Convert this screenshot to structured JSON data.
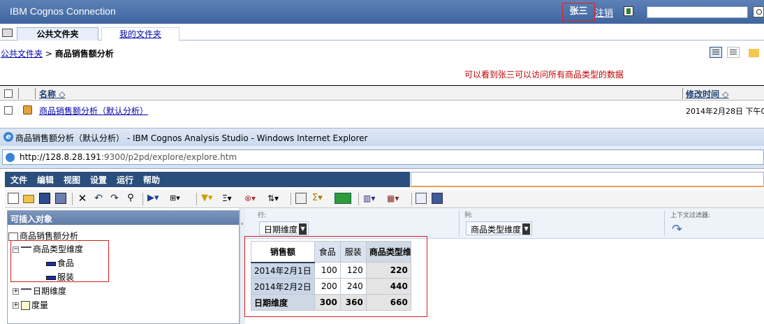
{
  "connection": {
    "app_title": "IBM Cognos Connection",
    "user_name": "张三",
    "logoff": "注销",
    "search_value": "",
    "tabs": [
      {
        "label": "公共文件夹"
      },
      {
        "label": "我的文件夹"
      }
    ],
    "breadcrumb": {
      "root": "公共文件夹",
      "separator": ">",
      "current": "商品销售额分析"
    },
    "annotation": "可以看到张三可以访问所有商品类型的数据",
    "list": {
      "col_name": "名称",
      "col_modified": "修改时间",
      "rows": [
        {
          "name": "商品销售额分析（默认分析）",
          "modified": "2014年2月28日  下午0"
        }
      ]
    }
  },
  "browser": {
    "window_title": "商品销售额分析（默认分析） - IBM Cognos Analysis Studio - Windows Internet Explorer",
    "url_host": "http://128.8.28.191",
    "url_rest": ":9300/p2pd/explore/explore.htm"
  },
  "analysis": {
    "menu": [
      "文件",
      "编辑",
      "视图",
      "设置",
      "运行",
      "帮助"
    ],
    "insertable": {
      "title": "可插入对象",
      "package": "商品销售额分析",
      "dimension_product": "商品类型维度",
      "levels": [
        "食品",
        "服装"
      ],
      "dimension_date": "日期维度",
      "measures": "度量"
    },
    "dropzones": {
      "rows_label": "行:",
      "rows_item": "日期维度",
      "cols_label": "列:",
      "cols_item": "商品类型维度",
      "context_label": "上下文过滤器:"
    },
    "crosstab": {
      "measure": "销售额",
      "columns": [
        "食品",
        "服装",
        "商品类型维度"
      ],
      "rows": [
        {
          "label": "2014年2月1日",
          "values": [
            "100",
            "120",
            "220"
          ]
        },
        {
          "label": "2014年2月2日",
          "values": [
            "200",
            "240",
            "440"
          ]
        }
      ],
      "total": {
        "label": "日期维度",
        "values": [
          "300",
          "360",
          "660"
        ]
      }
    }
  }
}
